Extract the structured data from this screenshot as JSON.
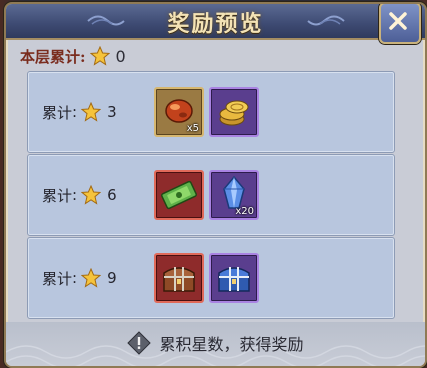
{
  "window": {
    "title": "奖励预览"
  },
  "summary": {
    "label": "本层累计:",
    "value": "0"
  },
  "tiers": [
    {
      "label": "累计",
      "colon": ":",
      "stars": "3",
      "rewards": [
        {
          "icon": "red-gem-icon",
          "quantity": "x5"
        },
        {
          "icon": "gold-coins-icon",
          "quantity": ""
        }
      ]
    },
    {
      "label": "累计",
      "colon": ":",
      "stars": "6",
      "rewards": [
        {
          "icon": "green-ticket-icon",
          "quantity": ""
        },
        {
          "icon": "blue-crystal-icon",
          "quantity": "x20"
        }
      ]
    },
    {
      "label": "累计",
      "colon": ":",
      "stars": "9",
      "rewards": [
        {
          "icon": "red-treasure-chest-icon",
          "quantity": ""
        },
        {
          "icon": "blue-treasure-chest-icon",
          "quantity": ""
        }
      ]
    }
  ],
  "footer": {
    "tip": "累积星数，获得奖励"
  },
  "colors": {
    "panel": "#c9ccd6",
    "tier_bg": "#b8c6de",
    "title": "#f4e3b6",
    "label_red": "#7a2c1e"
  }
}
